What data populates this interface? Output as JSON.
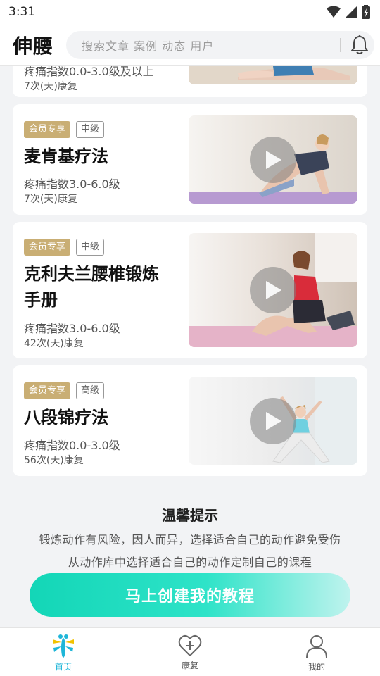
{
  "status_bar": {
    "time": "3:31"
  },
  "header": {
    "title": "伸腰",
    "search_placeholder": "搜索文章 案例 动态 用户"
  },
  "courses": [
    {
      "pain": "疼痛指数0.0-3.0级及以上",
      "days": "7次(天)康复"
    },
    {
      "badge": "会员专享",
      "level": "中级",
      "title_lines": [
        "麦肯基疗法"
      ],
      "pain": "疼痛指数3.0-6.0级",
      "days": "7次(天)康复"
    },
    {
      "badge": "会员专享",
      "level": "中级",
      "title_lines": [
        "克利夫兰腰椎锻炼",
        "手册"
      ],
      "pain": "疼痛指数3.0-6.0级",
      "days": "42次(天)康复"
    },
    {
      "badge": "会员专享",
      "level": "高级",
      "title_lines": [
        "八段锦疗法"
      ],
      "pain": "疼痛指数0.0-3.0级",
      "days": "56次(天)康复"
    }
  ],
  "tips": {
    "title": "温馨提示",
    "line1": "锻炼动作有风险，因人而异，选择适合自己的动作避免受伤",
    "line2": "从动作库中选择适合自己的动作定制自己的课程"
  },
  "cta_label": "马上创建我的教程",
  "tabs": [
    {
      "label": "首页",
      "icon": "dragonfly-icon",
      "active": true
    },
    {
      "label": "康复",
      "icon": "heart-plus-icon",
      "active": false
    },
    {
      "label": "我的",
      "icon": "user-icon",
      "active": false
    }
  ],
  "colors": {
    "accent": "#1fb6d8",
    "member_badge": "#c9ae74",
    "cta_start": "#13d6b7",
    "cta_end": "#bff3ee"
  }
}
